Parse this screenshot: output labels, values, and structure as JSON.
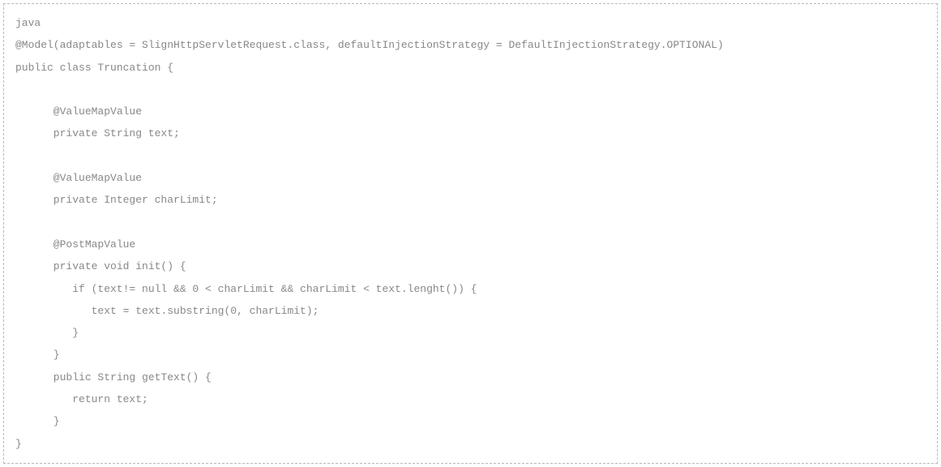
{
  "code": {
    "lines": [
      "java",
      "@Model(adaptables = SlignHttpServletRequest.class, defaultInjectionStrategy = DefaultInjectionStrategy.OPTIONAL)",
      "public class Truncation {",
      "",
      "      @ValueMapValue",
      "      private String text;",
      "",
      "      @ValueMapValue",
      "      private Integer charLimit;",
      "",
      "      @PostMapValue",
      "      private void init() {",
      "         if (text!= null && 0 < charLimit && charLimit < text.lenght()) {",
      "            text = text.substring(0, charLimit);",
      "         }",
      "      }",
      "      public String getText() {",
      "         return text;",
      "      }",
      "}"
    ]
  }
}
